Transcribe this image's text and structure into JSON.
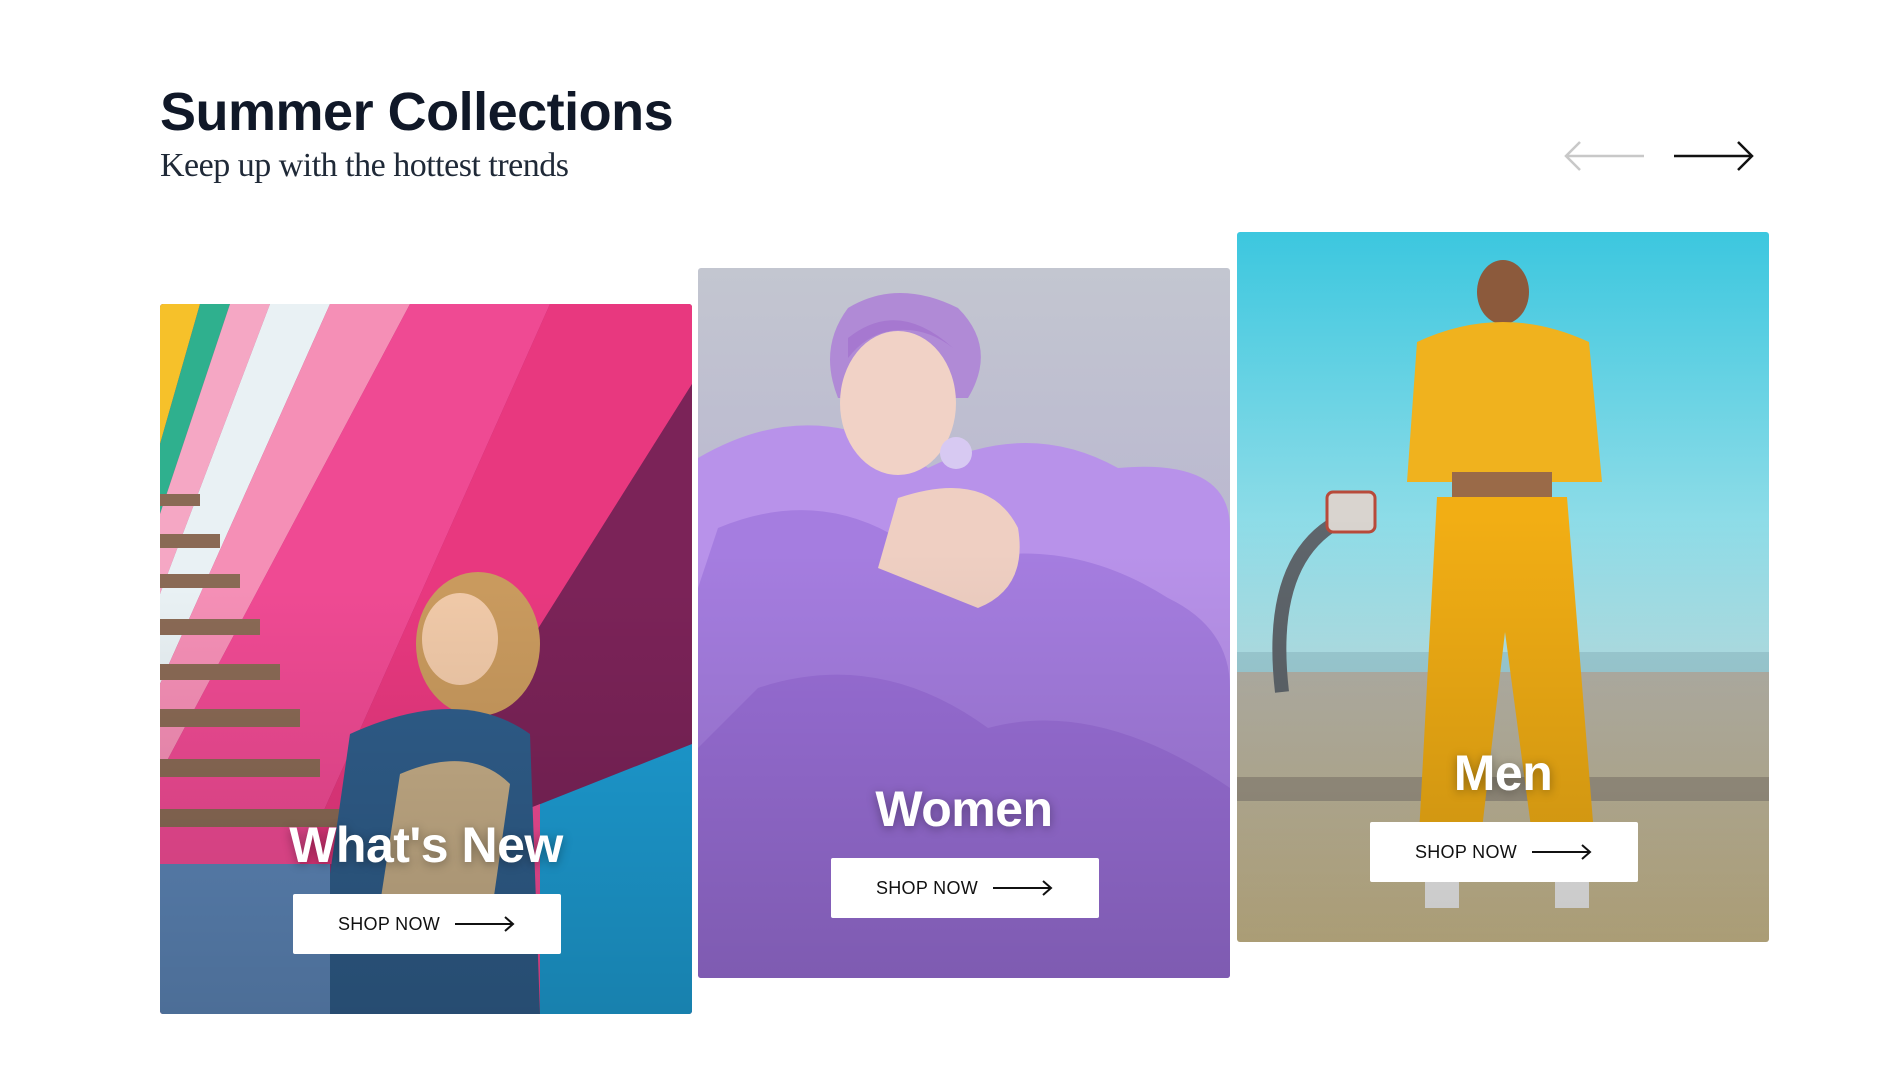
{
  "header": {
    "title": "Summer Collections",
    "subtitle": "Keep up with the hottest trends"
  },
  "carousel": {
    "prev_icon": "arrow-left-icon",
    "next_icon": "arrow-right-icon",
    "prev_disabled": true
  },
  "cards": [
    {
      "label": "What's New",
      "button": "SHOP NOW",
      "image": "woman-on-colorful-stairs"
    },
    {
      "label": "Women",
      "button": "SHOP NOW",
      "image": "woman-in-lavender-tulle"
    },
    {
      "label": "Men",
      "button": "SHOP NOW",
      "image": "model-in-yellow-tracksuit"
    }
  ],
  "colors": {
    "text": "#101828",
    "button_bg": "#ffffff",
    "disabled_arrow": "#c8c8c8"
  }
}
